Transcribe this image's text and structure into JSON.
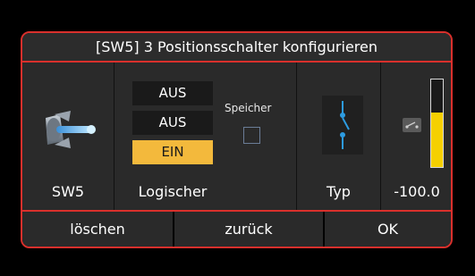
{
  "dialog": {
    "title": "[SW5]  3 Positionsschalter konfigurieren"
  },
  "switch_panel": {
    "icon": "toggle-switch-icon",
    "label": "SW5"
  },
  "logic_panel": {
    "options": [
      "AUS",
      "AUS",
      "EIN"
    ],
    "selected_index": 2,
    "label": "Logischer",
    "memory_label": "Speicher",
    "memory_checked": false
  },
  "type_panel": {
    "icon": "three-position-switch-icon",
    "label": "Typ"
  },
  "value_panel": {
    "icon": "switch-state-icon",
    "value": "-100.0",
    "bar_fill": 0.62
  },
  "buttons": {
    "delete": "löschen",
    "back": "zurück",
    "ok": "OK"
  },
  "colors": {
    "accent_red": "#d9302c",
    "active_yellow": "#f3b93c",
    "bar_yellow": "#f5d000"
  }
}
